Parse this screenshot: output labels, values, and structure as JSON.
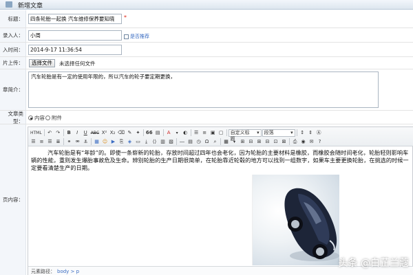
{
  "header": {
    "title": "新增文章"
  },
  "form": {
    "title_label": "标题：",
    "title_value": "四条轮胎一起换 汽车维修保养要知晓",
    "entry_person_label": "录入人：",
    "entry_person_value": "小周",
    "recommend_label": "是否推荐",
    "time_label": "入时间：",
    "time_value": "2014-9-17 11:36:54",
    "upload_label": "片上传：",
    "choose_file_button": "选择文件",
    "no_file_text": "未选择任何文件",
    "summary_label": "章简介：",
    "summary_value": "汽车轮胎是有一定的使用年限的，所以汽车的轮子要定期更换，",
    "type_label": "文章类型：",
    "type_content_label": "内容",
    "type_attachment_label": "附件",
    "content_label": "页内容："
  },
  "toolbar": {
    "html_label": "HTML",
    "custom_title_dropdown": "自定义标题",
    "paragraph_dropdown": "段落",
    "bold": "B",
    "italic": "I",
    "underline": "U",
    "strike": "ABC",
    "superscript": "X²",
    "subscript": "X₂",
    "quote": "66",
    "font_color": "A",
    "dropdown_arrow": "▾"
  },
  "editor": {
    "paragraph": "汽车轮胎是有“年龄”的。即使一条崭新的轮胎，存放时间超过四年也会老化，因为轮胎的主要材料是橡胶，而橡胶会随时间老化，轮胎轻则影响车辆的性能，重则发生爆胎事故危及生命。辨别轮胎的生产日期很简单，在轮胎靠近轮毂的地方可以找到一组数字，如果车主要更换轮胎，在挑选的时候一定要看清楚生产的日期。",
    "source_label": "元素路径：",
    "source_value": "body > p"
  },
  "watermark": "头条 @白芷兰蔻",
  "colors": {
    "accent": "#3a6cc2",
    "required": "#dd2211",
    "label_bg": "#f3f6fa"
  }
}
